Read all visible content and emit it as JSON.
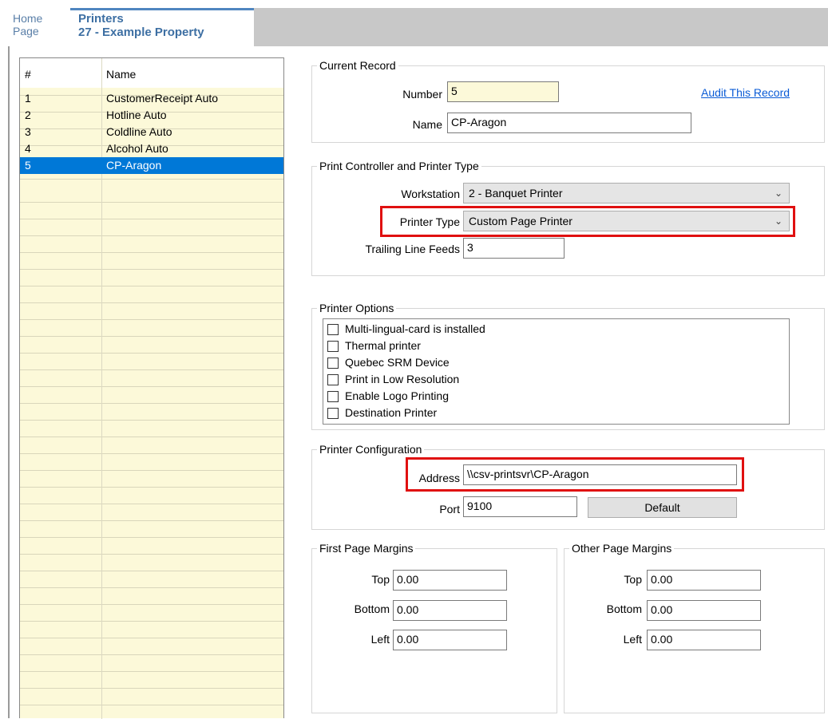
{
  "tabs": {
    "home_line1": "Home",
    "home_line2": "Page",
    "active_line1": "Printers",
    "active_line2": "27 - Example Property"
  },
  "grid": {
    "col_num": "#",
    "col_name": "Name",
    "rows": [
      {
        "num": "1",
        "name": "CustomerReceipt Auto"
      },
      {
        "num": "2",
        "name": "Hotline Auto"
      },
      {
        "num": "3",
        "name": "Coldline Auto"
      },
      {
        "num": "4",
        "name": "Alcohol Auto"
      },
      {
        "num": "5",
        "name": "CP-Aragon"
      }
    ],
    "selected_row": "5"
  },
  "current_record": {
    "title": "Current Record",
    "number_label": "Number",
    "number_value": "5",
    "name_label": "Name",
    "name_value": "CP-Aragon",
    "audit_link": "Audit This Record"
  },
  "print_controller": {
    "title": "Print Controller and Printer Type",
    "workstation_label": "Workstation",
    "workstation_value": "2 - Banquet Printer",
    "printer_type_label": "Printer Type",
    "printer_type_value": "Custom Page Printer",
    "trailing_label": "Trailing Line Feeds",
    "trailing_value": "3"
  },
  "printer_options": {
    "title": "Printer Options",
    "items": [
      {
        "label": "Multi-lingual-card is installed",
        "checked": false
      },
      {
        "label": "Thermal printer",
        "checked": false
      },
      {
        "label": "Quebec SRM Device",
        "checked": false
      },
      {
        "label": "Print in Low Resolution",
        "checked": false
      },
      {
        "label": "Enable Logo Printing",
        "checked": false
      },
      {
        "label": "Destination Printer",
        "checked": false
      }
    ]
  },
  "printer_config": {
    "title": "Printer Configuration",
    "address_label": "Address",
    "address_value": "\\\\csv-printsvr\\CP-Aragon",
    "port_label": "Port",
    "port_value": "9100",
    "default_button": "Default"
  },
  "first_margins": {
    "title": "First Page Margins",
    "top_label": "Top",
    "top_value": "0.00",
    "bottom_label": "Bottom",
    "bottom_value": "0.00",
    "left_label": "Left",
    "left_value": "0.00"
  },
  "other_margins": {
    "title": "Other Page Margins",
    "top_label": "Top",
    "top_value": "0.00",
    "bottom_label": "Bottom",
    "bottom_value": "0.00",
    "left_label": "Left",
    "left_value": "0.00"
  },
  "colors": {
    "highlight": "#e01010",
    "selection": "#0078d7",
    "grid_bg": "#fcf9d9",
    "link": "#0a5bd6"
  }
}
